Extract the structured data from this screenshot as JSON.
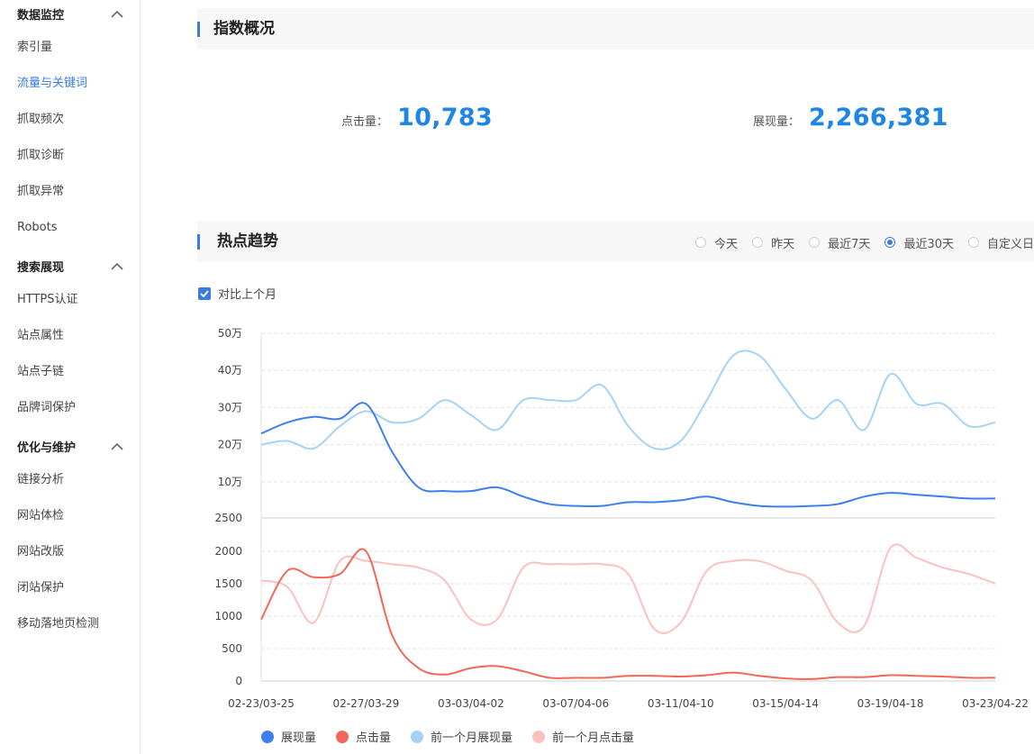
{
  "sidebar": {
    "groups": [
      {
        "title": "数据监控",
        "items": [
          "索引量",
          "流量与关键词",
          "抓取频次",
          "抓取诊断",
          "抓取异常",
          "Robots"
        ]
      },
      {
        "title": "搜索展现",
        "items": [
          "HTTPS认证",
          "站点属性",
          "站点子链",
          "品牌词保护"
        ]
      },
      {
        "title": "优化与维护",
        "items": [
          "链接分析",
          "网站体检",
          "网站改版",
          "闭站保护",
          "移动落地页检测"
        ]
      }
    ],
    "active_item": "流量与关键词"
  },
  "overview": {
    "title": "指数概况",
    "clicks_label": "点击量：",
    "clicks_value": "10,783",
    "impressions_label": "展现量：",
    "impressions_value": "2,266,381"
  },
  "trend": {
    "title": "热点趋势",
    "ranges": [
      "今天",
      "昨天",
      "最近7天",
      "最近30天",
      "自定义日"
    ],
    "selected_range": "最近30天",
    "compare_label": "对比上个月",
    "compare_checked": true
  },
  "colors": {
    "accent": "#3b7ddd",
    "metric": "#1f86e5",
    "impressions": "#3d7ff0",
    "clicks": "#f26757",
    "prev_impressions": "#a6d2f6",
    "prev_clicks": "#f9c2c0"
  },
  "chart_data": {
    "type": "line",
    "x": [
      "02-23/03-25",
      "02-24/03-26",
      "02-25/03-27",
      "02-26/03-28",
      "02-27/03-29",
      "02-28/03-30",
      "03-01/03-31",
      "03-02/04-01",
      "03-03/04-02",
      "03-04/04-03",
      "03-05/04-04",
      "03-06/04-05",
      "03-07/04-06",
      "03-08/04-07",
      "03-09/04-08",
      "03-10/04-09",
      "03-11/04-10",
      "03-12/04-11",
      "03-13/04-12",
      "03-14/04-13",
      "03-15/04-14",
      "03-16/04-15",
      "03-17/04-16",
      "03-18/04-17",
      "03-19/04-18",
      "03-20/04-19",
      "03-21/04-20",
      "03-22/04-21",
      "03-23/04-22"
    ],
    "x_tick_labels": [
      "02-23/03-25",
      "02-27/03-29",
      "03-03/04-02",
      "03-07/04-06",
      "03-11/04-10",
      "03-15/04-14",
      "03-19/04-18",
      "03-23/04-22"
    ],
    "upper_axis": {
      "ticks": [
        "50万",
        "40万",
        "30万",
        "20万",
        "10万",
        "2500"
      ],
      "values": [
        500000,
        400000,
        300000,
        200000,
        100000,
        2500
      ]
    },
    "lower_axis": {
      "ticks": [
        "2000",
        "1500",
        "1000",
        "500",
        "0"
      ],
      "values": [
        2000,
        1500,
        1000,
        500,
        0
      ]
    },
    "series": [
      {
        "name": "展现量",
        "axis": "upper",
        "values": [
          230000,
          260000,
          275000,
          270000,
          310000,
          180000,
          85000,
          75000,
          75000,
          85000,
          60000,
          40000,
          35000,
          35000,
          45000,
          45000,
          50000,
          60000,
          45000,
          35000,
          33000,
          35000,
          40000,
          60000,
          70000,
          65000,
          60000,
          55000,
          55000
        ]
      },
      {
        "name": "点击量",
        "axis": "lower",
        "values": [
          950,
          1700,
          1600,
          1650,
          2000,
          700,
          200,
          100,
          200,
          230,
          150,
          50,
          50,
          50,
          80,
          80,
          70,
          90,
          130,
          80,
          40,
          30,
          60,
          60,
          90,
          80,
          70,
          50,
          50
        ]
      },
      {
        "name": "前一个月展现量",
        "axis": "upper",
        "values": [
          200000,
          210000,
          190000,
          250000,
          290000,
          260000,
          270000,
          320000,
          280000,
          240000,
          320000,
          320000,
          320000,
          360000,
          250000,
          190000,
          210000,
          320000,
          440000,
          440000,
          350000,
          270000,
          320000,
          240000,
          390000,
          310000,
          310000,
          250000,
          260000
        ]
      },
      {
        "name": "前一个月点击量",
        "axis": "lower",
        "values": [
          1550,
          1450,
          900,
          1850,
          1850,
          1800,
          1750,
          1550,
          950,
          950,
          1750,
          1800,
          1800,
          1800,
          1650,
          800,
          900,
          1700,
          1850,
          1850,
          1700,
          1550,
          900,
          850,
          2050,
          1900,
          1750,
          1650,
          1500
        ]
      }
    ]
  },
  "legend": [
    "展现量",
    "点击量",
    "前一个月展现量",
    "前一个月点击量"
  ]
}
